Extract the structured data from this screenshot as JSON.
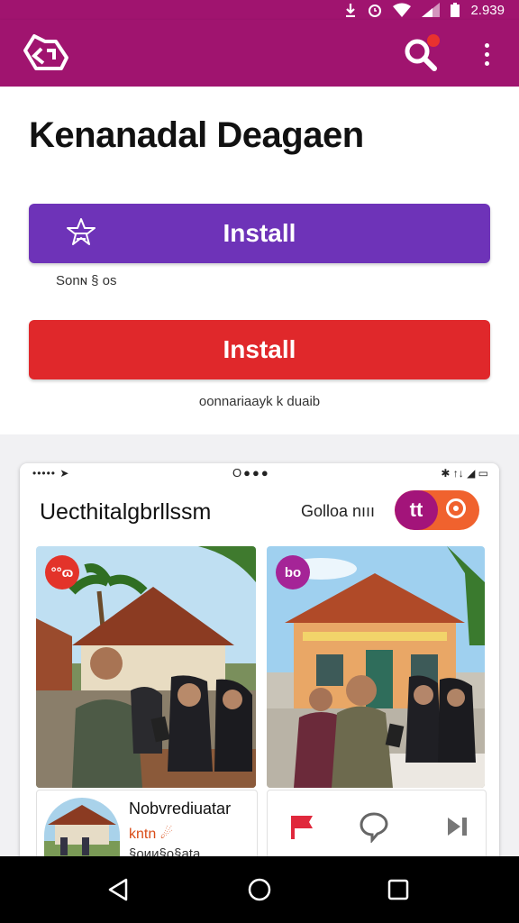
{
  "status_bar": {
    "time": "2.939",
    "icons": [
      "download-icon",
      "alarm-icon",
      "wifi-icon",
      "signal-icon",
      "battery-icon"
    ]
  },
  "app_bar": {
    "logo": "app-logo-icon",
    "search_icon": "search-icon",
    "menu_icon": "more-vert-icon",
    "color": "#a0146f"
  },
  "main": {
    "title": "Kenanadal Deagaen",
    "primary_button": {
      "label": "Install",
      "color": "#6e33b8",
      "icon": "star-cart-icon"
    },
    "primary_caption": "Sonɴ § os",
    "secondary_button": {
      "label": "Install",
      "color": "#e0282b"
    },
    "secondary_caption": "oonnariaayk k duaib"
  },
  "preview_card": {
    "status_left": "••••• ➤",
    "status_center": "O●●●",
    "status_right": "✱ ↑↓ ◢ ▭",
    "title": "Uecthitalgbrllssm",
    "label": "Golloa nııı",
    "toggle_text": "tt",
    "photos": [
      {
        "badge": "°°ɷ",
        "badge_color": "#e3332a"
      },
      {
        "badge": "bo",
        "badge_color": "#a52497"
      }
    ],
    "info": {
      "name": "Nobvrediuatar",
      "sub": "kntn ☄",
      "sub2": "§oии§o§ata"
    },
    "actions": [
      "flag-icon",
      "chat-bubble-icon",
      "skip-icon"
    ]
  },
  "nav_bar": {
    "buttons": [
      "back-icon",
      "home-icon",
      "recents-icon"
    ]
  }
}
